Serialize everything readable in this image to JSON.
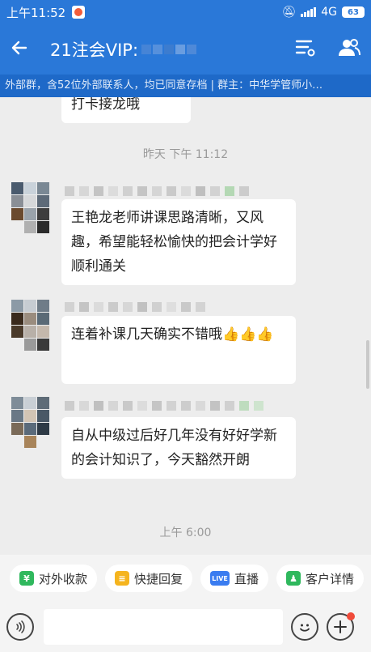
{
  "status_bar": {
    "time": "上午11:52",
    "network": "4G",
    "battery": "63"
  },
  "header": {
    "title": "21注会VIP:",
    "back_icon": "arrow-left-icon",
    "menu_icon": "list-settings-icon",
    "members_icon": "group-members-icon"
  },
  "info_bar": {
    "text": "外部群，含52位外部联系人，均已同意存档 | 群主：中华学管师小…"
  },
  "chat": {
    "messages": [
      {
        "text": "打卡接龙哦"
      },
      {
        "timestamp": "昨天 下午 11:12"
      },
      {
        "text": "王艳龙老师讲课思路清晰，又风趣，希望能轻松愉快的把会计学好顺利通关"
      },
      {
        "text": "连着补课几天确实不错哦👍👍👍"
      },
      {
        "text": "自从中级过后好几年没有好好学新的会计知识了，今天豁然开朗"
      },
      {
        "timestamp": "上午 6:00"
      }
    ]
  },
  "quick_actions": [
    {
      "label": "对外收款",
      "icon": "yuan-icon",
      "color": "#2fb85d",
      "glyph": "¥"
    },
    {
      "label": "快捷回复",
      "icon": "quick-reply-icon",
      "color": "#f5b41e",
      "glyph": "≡"
    },
    {
      "label": "直播",
      "icon": "live-icon",
      "color": "#3a7cf0",
      "glyph": "LIVE"
    },
    {
      "label": "客户详情",
      "icon": "customer-icon",
      "color": "#2fb85d",
      "glyph": "♟"
    }
  ],
  "input_bar": {
    "voice_icon": "voice-icon",
    "emoji_icon": "emoji-icon",
    "plus_icon": "plus-icon"
  }
}
